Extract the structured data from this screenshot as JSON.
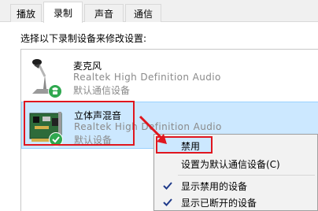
{
  "tabs": [
    {
      "label": "播放",
      "active": false
    },
    {
      "label": "录制",
      "active": true
    },
    {
      "label": "声音",
      "active": false
    },
    {
      "label": "通信",
      "active": false
    }
  ],
  "instruction": "选择以下录制设备来修改设置:",
  "devices": [
    {
      "name": "麦克风",
      "driver": "Realtek High Definition Audio",
      "status": "默认通信设备",
      "icon": "microphone-icon",
      "badge": "phone-badge-icon"
    },
    {
      "name": "立体声混音",
      "driver": "Realtek High Definition Audio",
      "status": "默认设备",
      "icon": "sound-card-icon",
      "badge": "check-badge-icon"
    }
  ],
  "context_menu": {
    "items": [
      {
        "label": "禁用",
        "checked": false,
        "highlighted": true
      },
      {
        "label": "设置为默认通信设备(C)",
        "checked": false,
        "highlighted": false
      },
      {
        "label": "显示禁用的设备",
        "checked": true,
        "highlighted": false
      },
      {
        "label": "显示已断开的设备",
        "checked": true,
        "highlighted": false
      }
    ]
  },
  "colors": {
    "selection": "#cce8ff",
    "annotation_red": "#e0161e",
    "badge_green": "#2fa84f"
  }
}
